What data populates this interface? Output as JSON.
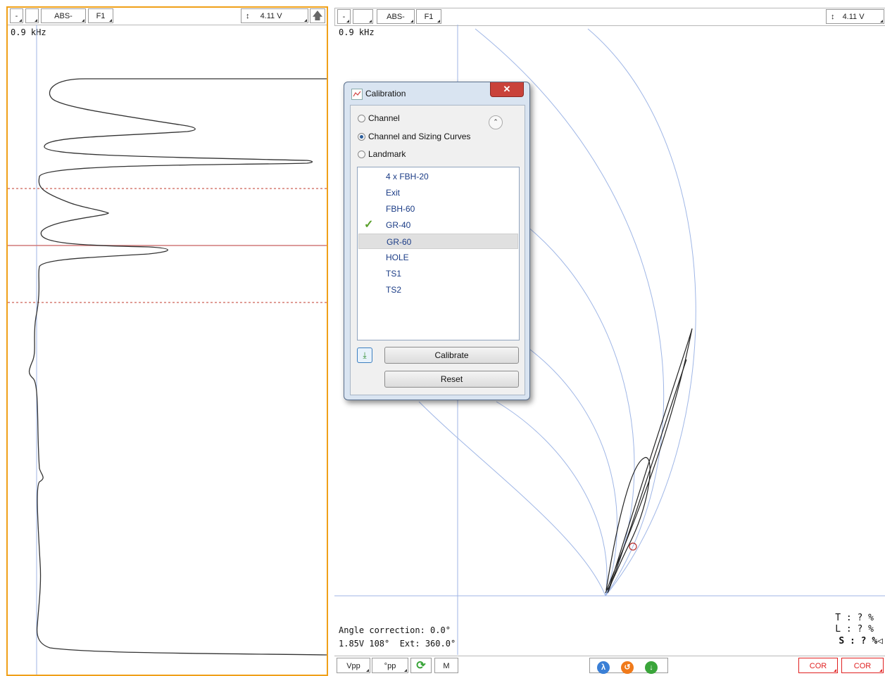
{
  "left_panel": {
    "toolbar": {
      "minus": "-",
      "blank": "",
      "mode": "ABS-",
      "filter": "F1",
      "scale_icon": "updown-arrow-icon",
      "scale": "4.11 V",
      "up_icon": "up-arrow-icon"
    },
    "frequency": "0.9 kHz"
  },
  "right_panel": {
    "toolbar": {
      "minus": "-",
      "blank": "",
      "mode": "ABS-",
      "filter": "F1",
      "scale_icon": "updown-arrow-icon",
      "scale": "4.11 V"
    },
    "frequency": "0.9 kHz",
    "status": {
      "angle_correction": "Angle correction: 0.0°",
      "readout": "1.85V 108°  Ext: 360.0°"
    },
    "percentages": {
      "t": "T : ? %",
      "l": "L : ? %",
      "s": "S : ? %◁"
    },
    "bottom_bar": {
      "vpp": "Vpp",
      "vpp2": "°pp",
      "refresh_icon": "refresh-icon",
      "m": "M",
      "icons": [
        "lambda-icon",
        "rotate-icon",
        "download-icon"
      ],
      "cor1": "COR",
      "cor2": "COR"
    }
  },
  "dialog": {
    "title": "Calibration",
    "close": "✕",
    "radios": [
      {
        "label": "Channel",
        "selected": false
      },
      {
        "label": "Channel and Sizing Curves",
        "selected": true
      },
      {
        "label": "Landmark",
        "selected": false
      }
    ],
    "items": [
      {
        "label": "4 x FBH-20",
        "checked": false,
        "selected": false
      },
      {
        "label": "Exit",
        "checked": false,
        "selected": false
      },
      {
        "label": "FBH-60",
        "checked": false,
        "selected": false
      },
      {
        "label": "GR-40",
        "checked": true,
        "selected": false
      },
      {
        "label": "GR-60",
        "checked": false,
        "selected": true
      },
      {
        "label": "HOLE",
        "checked": false,
        "selected": false
      },
      {
        "label": "TS1",
        "checked": false,
        "selected": false
      },
      {
        "label": "TS2",
        "checked": false,
        "selected": false
      }
    ],
    "calibrate": "Calibrate",
    "reset": "Reset",
    "colors": {
      "accent": "#f0a018",
      "link": "#1b3c86",
      "check": "#5aa02c",
      "close": "#c9423a"
    }
  }
}
